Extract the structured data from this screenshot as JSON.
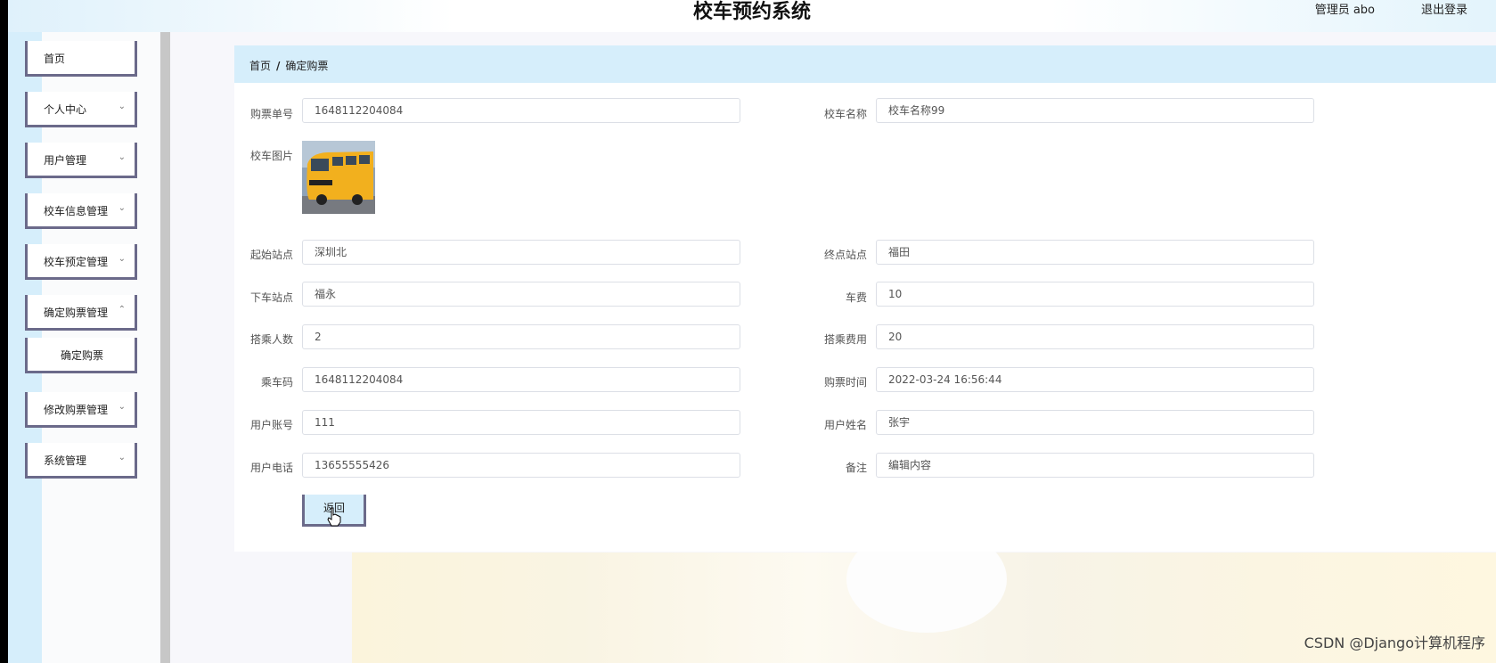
{
  "header": {
    "title": "校车预约系统",
    "user_info": "管理员 abo",
    "logout": "退出登录"
  },
  "sidebar": {
    "items": [
      {
        "label": "首页",
        "has_arrow": false
      },
      {
        "label": "个人中心",
        "has_arrow": true
      },
      {
        "label": "用户管理",
        "has_arrow": true
      },
      {
        "label": "校车信息管理",
        "has_arrow": true
      },
      {
        "label": "校车预定管理",
        "has_arrow": true
      },
      {
        "label": "确定购票管理",
        "has_arrow": true
      },
      {
        "label": "确定购票",
        "has_arrow": false,
        "sub": true
      },
      {
        "label": "修改购票管理",
        "has_arrow": true
      },
      {
        "label": "系统管理",
        "has_arrow": true
      }
    ]
  },
  "breadcrumb": {
    "home": "首页",
    "separator": "/",
    "current": "确定购票"
  },
  "form": {
    "ticket_no": {
      "label": "购票单号",
      "value": "1648112204084"
    },
    "bus_name": {
      "label": "校车名称",
      "value": "校车名称99"
    },
    "bus_image": {
      "label": "校车图片"
    },
    "start_station": {
      "label": "起始站点",
      "value": "深圳北"
    },
    "end_station": {
      "label": "终点站点",
      "value": "福田"
    },
    "drop_station": {
      "label": "下车站点",
      "value": "福永"
    },
    "fare": {
      "label": "车费",
      "value": "10"
    },
    "passengers": {
      "label": "搭乘人数",
      "value": "2"
    },
    "total_fee": {
      "label": "搭乘费用",
      "value": "20"
    },
    "ride_code": {
      "label": "乘车码",
      "value": "1648112204084"
    },
    "purchase_time": {
      "label": "购票时间",
      "value": "2022-03-24 16:56:44"
    },
    "user_account": {
      "label": "用户账号",
      "value": "111"
    },
    "user_name": {
      "label": "用户姓名",
      "value": "张宇"
    },
    "user_phone": {
      "label": "用户电话",
      "value": "13655555426"
    },
    "remark": {
      "label": "备注",
      "value": "编辑内容"
    }
  },
  "actions": {
    "back": "返回"
  },
  "watermark": "CSDN @Django计算机程序",
  "colors": {
    "accent_blue": "#d6eefb",
    "menu_border": "#6b6a8a"
  }
}
